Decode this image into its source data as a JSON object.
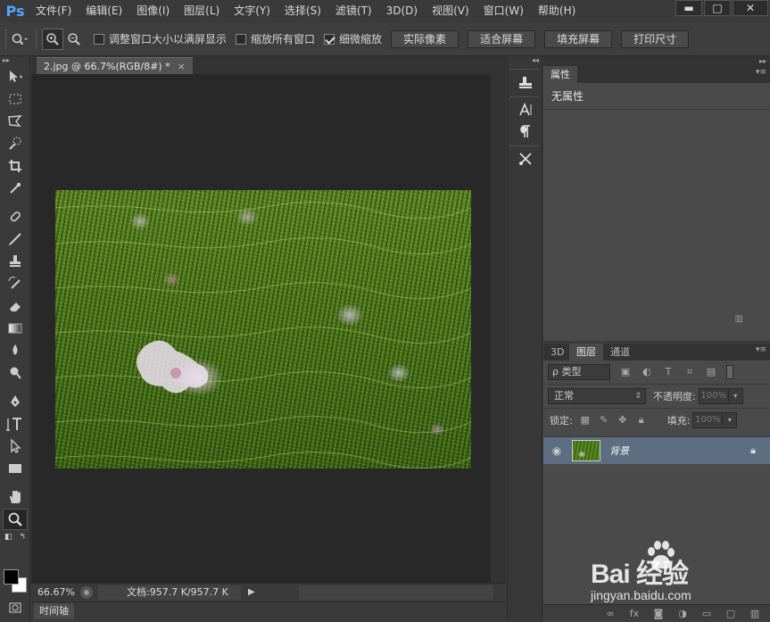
{
  "app": {
    "logo": "Ps"
  },
  "menu": [
    "文件(F)",
    "编辑(E)",
    "图像(I)",
    "图层(L)",
    "文字(Y)",
    "选择(S)",
    "滤镜(T)",
    "3D(D)",
    "视图(V)",
    "窗口(W)",
    "帮助(H)"
  ],
  "window_controls": {
    "minimize": "▬",
    "maximize": "□",
    "close": "✕"
  },
  "options": {
    "tool_icon": "zoom-icon",
    "checkboxes": [
      {
        "label": "调整窗口大小以满屏显示",
        "checked": false
      },
      {
        "label": "缩放所有窗口",
        "checked": false
      },
      {
        "label": "细微缩放",
        "checked": true
      }
    ],
    "buttons": [
      "实际像素",
      "适合屏幕",
      "填充屏幕",
      "打印尺寸"
    ]
  },
  "document": {
    "tab_title": "2.jpg @ 66.7%(RGB/8#) *",
    "tab_close": "×",
    "zoom": "66.67%",
    "doc_info": "文档:957.7 K/957.7 K",
    "status_arrow": "▶"
  },
  "timeline": {
    "tab": "时间轴"
  },
  "properties": {
    "tab": "属性",
    "content": "无属性"
  },
  "layers_panel": {
    "tabs": [
      "3D",
      "图层",
      "通道"
    ],
    "active_tab": "图层",
    "filter_label": "ρ 类型",
    "blend_mode": "正常",
    "opacity_label": "不透明度:",
    "opacity_value": "100%",
    "lock_label": "锁定:",
    "fill_label": "填充:",
    "fill_value": "100%",
    "layers": [
      {
        "name": "背景",
        "visible": true,
        "locked": true
      }
    ]
  },
  "watermark": {
    "logo": "Bai  经验",
    "url": "jingyan.baidu.com"
  },
  "colors": {
    "accent_ps": "#4ea8ff",
    "selected_layer": "#5d6e82",
    "foreground": "#000000",
    "background": "#ffffff"
  }
}
